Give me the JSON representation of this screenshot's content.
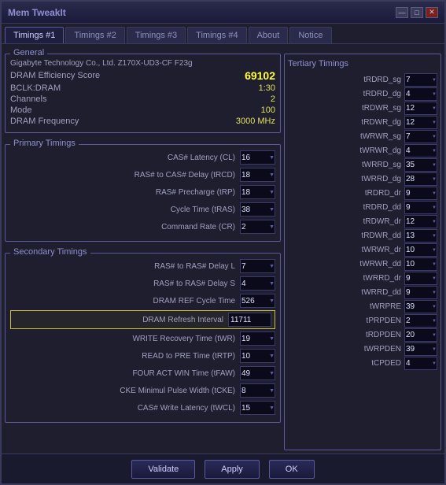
{
  "window": {
    "title": "Mem TweakIt",
    "controls": [
      "—",
      "□",
      "✕"
    ]
  },
  "tabs": [
    {
      "label": "Timings #1",
      "active": true
    },
    {
      "label": "Timings #2",
      "active": false
    },
    {
      "label": "Timings #3",
      "active": false
    },
    {
      "label": "Timings #4",
      "active": false
    },
    {
      "label": "About",
      "active": false
    },
    {
      "label": "Notice",
      "active": false
    }
  ],
  "general": {
    "group_label": "General",
    "manufacturer": "Gigabyte Technology Co., Ltd. Z170X-UD3-CF F23g",
    "dram_score_label": "DRAM Efficiency Score",
    "dram_score_value": "69102",
    "bclk_label": "BCLK:DRAM",
    "bclk_value": "1:30",
    "channels_label": "Channels",
    "channels_value": "2",
    "mode_label": "Mode",
    "mode_value": "100",
    "freq_label": "DRAM Frequency",
    "freq_value": "3000 MHz"
  },
  "primary": {
    "group_label": "Primary Timings",
    "timings": [
      {
        "label": "CAS# Latency (CL)",
        "value": "16"
      },
      {
        "label": "RAS# to CAS# Delay (tRCD)",
        "value": "18"
      },
      {
        "label": "RAS# Precharge (tRP)",
        "value": "18"
      },
      {
        "label": "Cycle Time (tRAS)",
        "value": "38"
      },
      {
        "label": "Command Rate (CR)",
        "value": "2"
      }
    ]
  },
  "secondary": {
    "group_label": "Secondary Timings",
    "timings": [
      {
        "label": "RAS# to RAS# Delay L",
        "value": "7"
      },
      {
        "label": "RAS# to RAS# Delay S",
        "value": "4"
      },
      {
        "label": "DRAM REF Cycle Time",
        "value": "526"
      },
      {
        "label": "WRITE Recovery Time (tWR)",
        "value": "19"
      },
      {
        "label": "READ to PRE Time (tRTP)",
        "value": "10"
      },
      {
        "label": "FOUR ACT WIN Time (tFAW)",
        "value": "49"
      },
      {
        "label": "CKE Minimul Pulse Width (tCKE)",
        "value": "8"
      },
      {
        "label": "CAS# Write Latency (tWCL)",
        "value": "15"
      }
    ],
    "refresh_interval_label": "DRAM Refresh Interval",
    "refresh_interval_value": "11711"
  },
  "tertiary": {
    "group_label": "Tertiary Timings",
    "timings": [
      {
        "label": "tRDRD_sg",
        "value": "7"
      },
      {
        "label": "tRDRD_dg",
        "value": "4"
      },
      {
        "label": "tRDWR_sg",
        "value": "12"
      },
      {
        "label": "tRDWR_dg",
        "value": "12"
      },
      {
        "label": "tWRWR_sg",
        "value": "7"
      },
      {
        "label": "tWRWR_dg",
        "value": "4"
      },
      {
        "label": "tWRRD_sg",
        "value": "35"
      },
      {
        "label": "tWRRD_dg",
        "value": "28"
      },
      {
        "label": "tRDRD_dr",
        "value": "9"
      },
      {
        "label": "tRDRD_dd",
        "value": "9"
      },
      {
        "label": "tRDWR_dr",
        "value": "12"
      },
      {
        "label": "tRDWR_dd",
        "value": "13"
      },
      {
        "label": "tWRWR_dr",
        "value": "10"
      },
      {
        "label": "tWRWR_dd",
        "value": "10"
      },
      {
        "label": "tWRRD_dr",
        "value": "9"
      },
      {
        "label": "tWRRD_dd",
        "value": "9"
      },
      {
        "label": "tWRPRE",
        "value": "39"
      },
      {
        "label": "tPRPDEN",
        "value": "2"
      },
      {
        "label": "tRDPDEN",
        "value": "20"
      },
      {
        "label": "tWRPDEN",
        "value": "39"
      },
      {
        "label": "tCPDED",
        "value": "4"
      }
    ]
  },
  "buttons": {
    "validate": "Validate",
    "apply": "Apply",
    "ok": "OK"
  }
}
